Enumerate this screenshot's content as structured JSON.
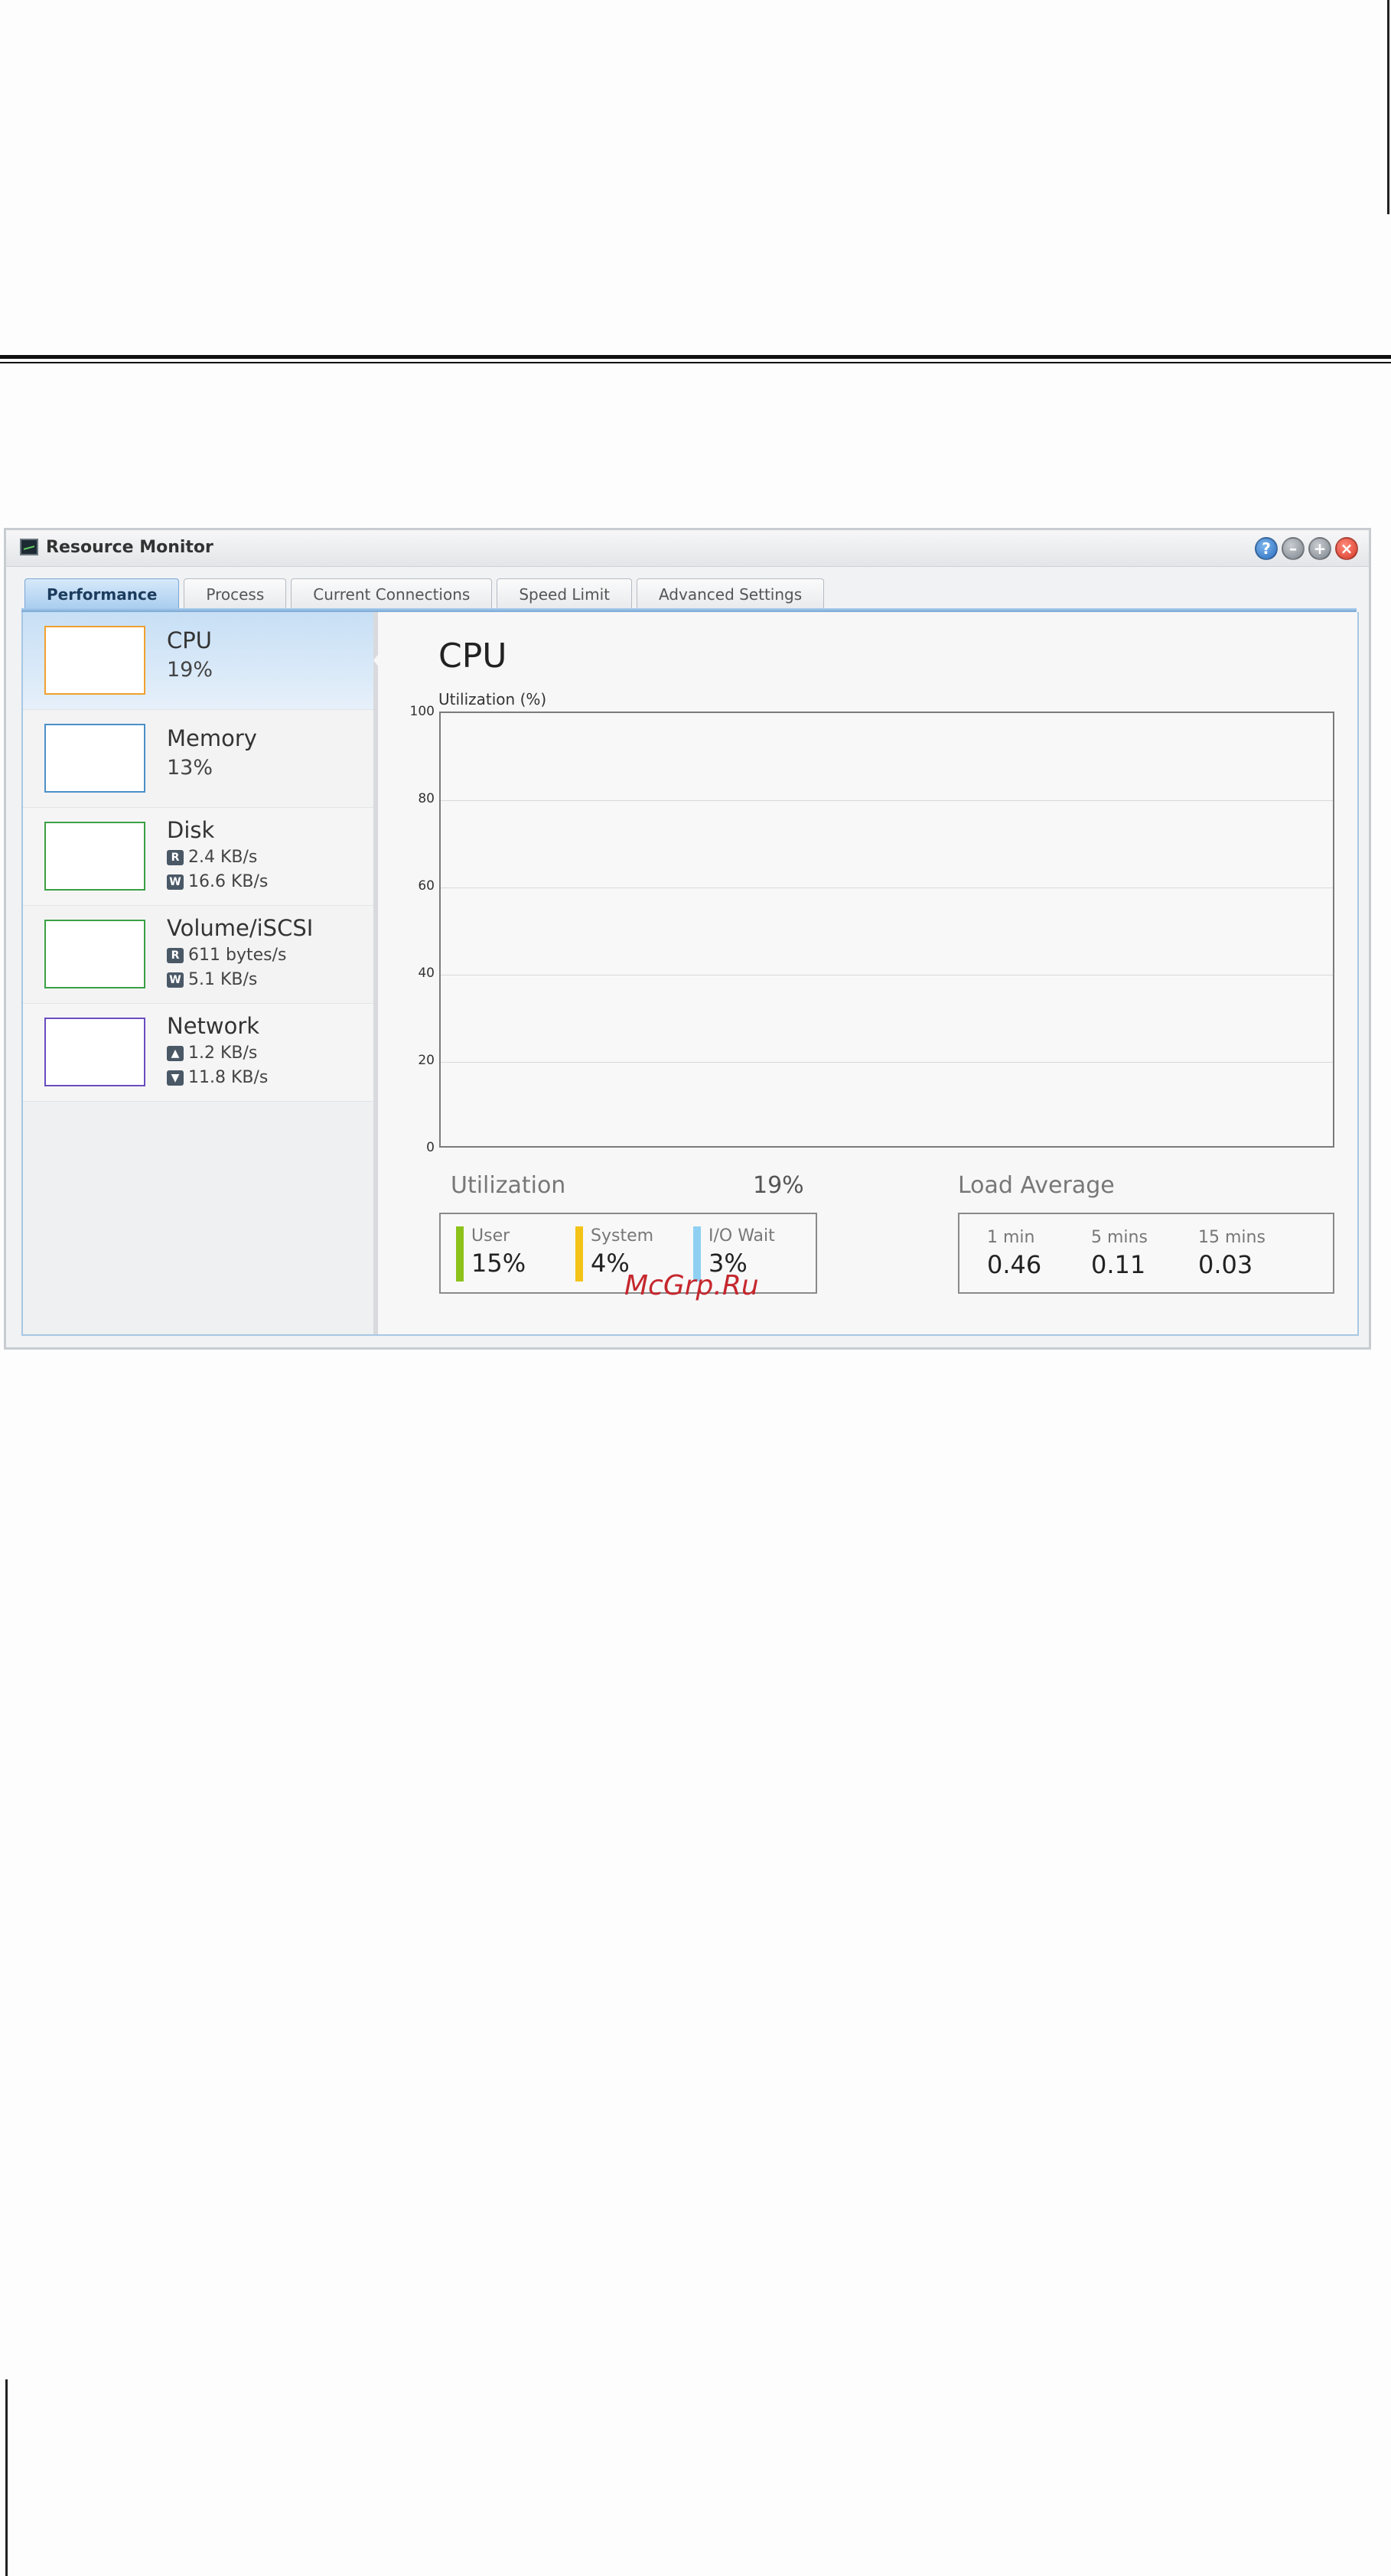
{
  "window": {
    "title": "Resource Monitor"
  },
  "tabs": [
    {
      "label": "Performance",
      "active": true
    },
    {
      "label": "Process"
    },
    {
      "label": "Current Connections"
    },
    {
      "label": "Speed Limit"
    },
    {
      "label": "Advanced Settings"
    }
  ],
  "sidebar": {
    "cpu": {
      "name": "CPU",
      "value": "19%",
      "color": "#f0a030"
    },
    "memory": {
      "name": "Memory",
      "value": "13%",
      "color": "#4a90c8"
    },
    "disk": {
      "name": "Disk",
      "read_badge": "R",
      "read": "2.4 KB/s",
      "write_badge": "W",
      "write": "16.6 KB/s",
      "color": "#3aa043"
    },
    "volume": {
      "name": "Volume/iSCSI",
      "read_badge": "R",
      "read": "611 bytes/s",
      "write_badge": "W",
      "write": "5.1 KB/s",
      "color": "#3aa043"
    },
    "network": {
      "name": "Network",
      "up": "1.2 KB/s",
      "down": "11.8 KB/s",
      "color": "#6a4cc0"
    }
  },
  "main": {
    "title": "CPU",
    "plot_label": "Utilization (%)",
    "y_ticks": [
      "100",
      "80",
      "60",
      "40",
      "20",
      "0"
    ],
    "utilization": {
      "title": "Utilization",
      "total": "19%",
      "user": {
        "label": "User",
        "value": "15%",
        "color": "#8cc21a"
      },
      "system": {
        "label": "System",
        "value": "4%",
        "color": "#f3c317"
      },
      "iowait": {
        "label": "I/O Wait",
        "value": "3%",
        "color": "#8fd0f2"
      }
    },
    "load_average": {
      "title": "Load Average",
      "min1": {
        "label": "1 min",
        "value": "0.46"
      },
      "min5": {
        "label": "5 mins",
        "value": "0.11"
      },
      "min15": {
        "label": "15 mins",
        "value": "0.03"
      }
    }
  },
  "watermark": "McGrp.Ru"
}
